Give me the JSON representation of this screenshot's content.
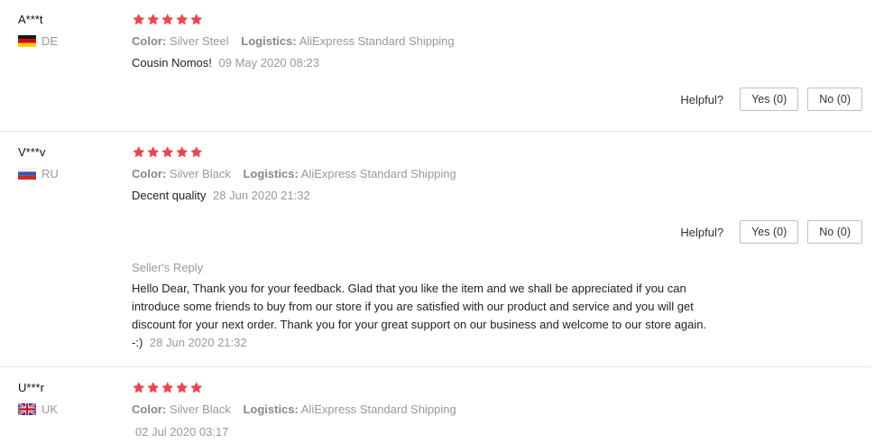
{
  "colors": {
    "star": "#f0424f",
    "divider": "#e8e8e8"
  },
  "helpful_label": "Helpful?",
  "reviews": [
    {
      "user": "A***t",
      "country": "DE",
      "flag": "germany-flag-icon",
      "stars": 5,
      "color_label": "Color:",
      "color_value": "Silver Steel",
      "logistics_label": "Logistics:",
      "logistics_value": "AliExpress Standard Shipping",
      "text": "Cousin Nomos!",
      "date": "09 May 2020 08:23",
      "yes": "Yes (0)",
      "no": "No (0)"
    },
    {
      "user": "V***v",
      "country": "RU",
      "flag": "russia-flag-icon",
      "stars": 5,
      "color_label": "Color:",
      "color_value": "Silver Black",
      "logistics_label": "Logistics:",
      "logistics_value": "AliExpress Standard Shipping",
      "text": "Decent quality",
      "date": "28 Jun 2020 21:32",
      "yes": "Yes (0)",
      "no": "No (0)",
      "reply_title": "Seller's Reply",
      "reply_line1": "Hello Dear, Thank you for your feedback. Glad that you like the item and we shall be appreciated if you can",
      "reply_line2": "introduce some friends to buy from our store if you are satisfied with our product and service and you will get",
      "reply_line3": "discount for your next order. Thank you for your great support on our business and welcome to our store again.",
      "reply_line4": "-:)",
      "reply_date": "28 Jun 2020 21:32"
    },
    {
      "user": "U***r",
      "country": "UK",
      "flag": "uk-flag-icon",
      "stars": 5,
      "color_label": "Color:",
      "color_value": "Silver Black",
      "logistics_label": "Logistics:",
      "logistics_value": "AliExpress Standard Shipping",
      "date": "02 Jul 2020 03:17"
    }
  ]
}
